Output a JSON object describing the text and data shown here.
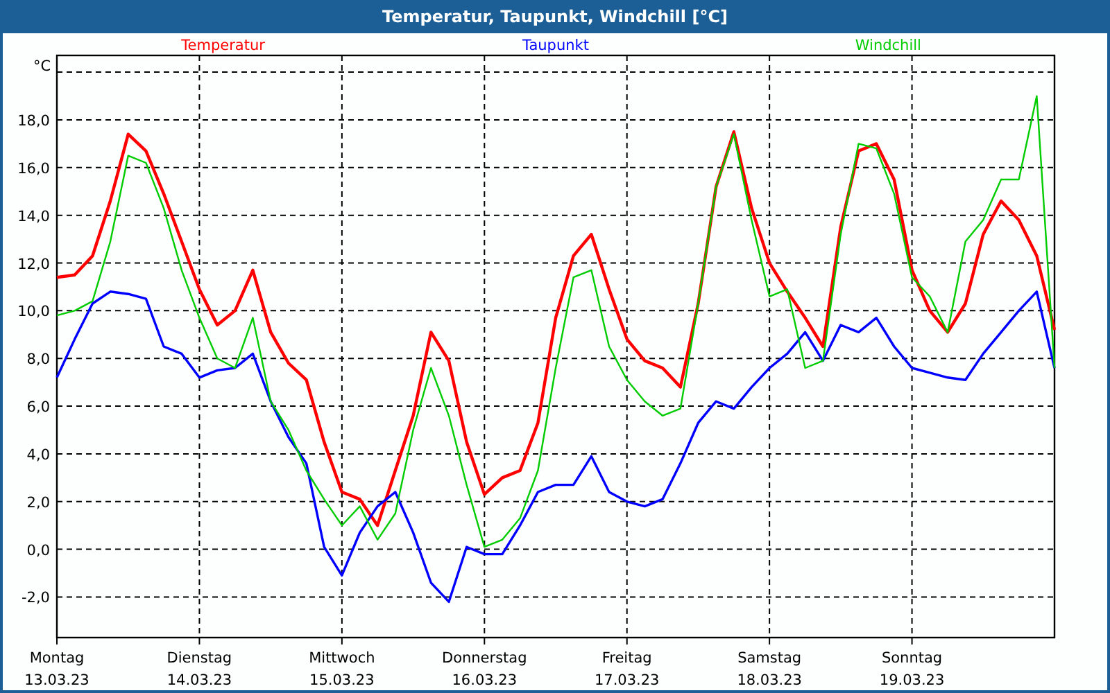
{
  "window": {
    "title": "Temperatur, Taupunkt, Windchill [°C]"
  },
  "chart": {
    "dates": [
      "13.03.23",
      "14.03.23",
      "15.03.23",
      "16.03.23",
      "17.03.23",
      "18.03.23",
      "19.03.23"
    ],
    "chart_data": {
      "type": "line",
      "grid": true,
      "ylabel": "°C",
      "ylim": [
        -3.7,
        20.7
      ],
      "categories": [
        "Montag",
        null,
        null,
        null,
        null,
        null,
        null,
        null,
        "Dienstag",
        null,
        null,
        null,
        null,
        null,
        null,
        null,
        "Mittwoch",
        null,
        null,
        null,
        null,
        null,
        null,
        null,
        "Donnerstag",
        null,
        null,
        null,
        null,
        null,
        null,
        null,
        "Freitag",
        null,
        null,
        null,
        null,
        null,
        null,
        null,
        "Samstag",
        null,
        null,
        null,
        null,
        null,
        null,
        null,
        "Sonntag",
        null,
        null,
        null,
        null,
        null,
        null,
        null,
        null
      ],
      "yticks": [
        {
          "value": -2,
          "label": "-2,0"
        },
        {
          "value": 0,
          "label": "0,0"
        },
        {
          "value": 2,
          "label": "2,0"
        },
        {
          "value": 4,
          "label": "4,0"
        },
        {
          "value": 6,
          "label": "6,0"
        },
        {
          "value": 8,
          "label": "8,0"
        },
        {
          "value": 10,
          "label": "10,0"
        },
        {
          "value": 12,
          "label": "12,0"
        },
        {
          "value": 14,
          "label": "14,0"
        },
        {
          "value": 16,
          "label": "16,0"
        },
        {
          "value": 18,
          "label": "18,0"
        }
      ],
      "series": [
        {
          "name": "Temperatur",
          "color": "#ff0000",
          "values": [
            11.4,
            11.5,
            12.3,
            14.6,
            17.4,
            16.7,
            14.9,
            12.9,
            10.9,
            9.4,
            10.0,
            11.7,
            9.1,
            7.8,
            7.1,
            4.5,
            2.4,
            2.1,
            1.0,
            3.3,
            5.6,
            9.1,
            7.9,
            4.5,
            2.3,
            3.0,
            3.3,
            5.3,
            9.7,
            12.3,
            13.2,
            10.9,
            8.8,
            7.9,
            7.6,
            6.8,
            10.3,
            15.2,
            17.5,
            14.3,
            12.0,
            10.8,
            9.7,
            8.5,
            13.5,
            16.7,
            17.0,
            15.5,
            11.7,
            10.0,
            9.1,
            10.3,
            13.2,
            14.6,
            13.8,
            12.3,
            9.2
          ]
        },
        {
          "name": "Taupunkt",
          "color": "#0000ff",
          "values": [
            7.2,
            8.8,
            10.3,
            10.8,
            10.7,
            10.5,
            8.5,
            8.2,
            7.2,
            7.5,
            7.6,
            8.2,
            6.2,
            4.7,
            3.6,
            0.1,
            -1.1,
            0.7,
            1.8,
            2.4,
            0.7,
            -1.4,
            -2.2,
            0.1,
            -0.2,
            -0.2,
            1.0,
            2.4,
            2.7,
            2.7,
            3.9,
            2.4,
            2.0,
            1.8,
            2.1,
            3.6,
            5.3,
            6.2,
            5.9,
            6.8,
            7.6,
            8.2,
            9.1,
            7.9,
            9.4,
            9.1,
            9.7,
            8.5,
            7.6,
            7.4,
            7.2,
            7.1,
            8.2,
            9.1,
            10.0,
            10.8,
            7.6
          ]
        },
        {
          "name": "Windchill",
          "color": "#00cc00",
          "values": [
            9.8,
            10.0,
            10.4,
            12.9,
            16.5,
            16.2,
            14.3,
            11.7,
            9.7,
            8.0,
            7.6,
            9.7,
            6.2,
            5.0,
            3.3,
            2.1,
            1.0,
            1.8,
            0.4,
            1.5,
            5.0,
            7.6,
            5.6,
            2.7,
            0.1,
            0.4,
            1.3,
            3.3,
            7.6,
            11.4,
            11.7,
            8.5,
            7.1,
            6.2,
            5.6,
            5.9,
            10.3,
            15.2,
            17.4,
            13.8,
            10.6,
            10.9,
            7.6,
            7.9,
            13.2,
            17.0,
            16.8,
            14.9,
            11.4,
            10.6,
            9.1,
            12.9,
            13.8,
            15.5,
            15.5,
            19.0,
            7.6
          ]
        }
      ]
    }
  }
}
